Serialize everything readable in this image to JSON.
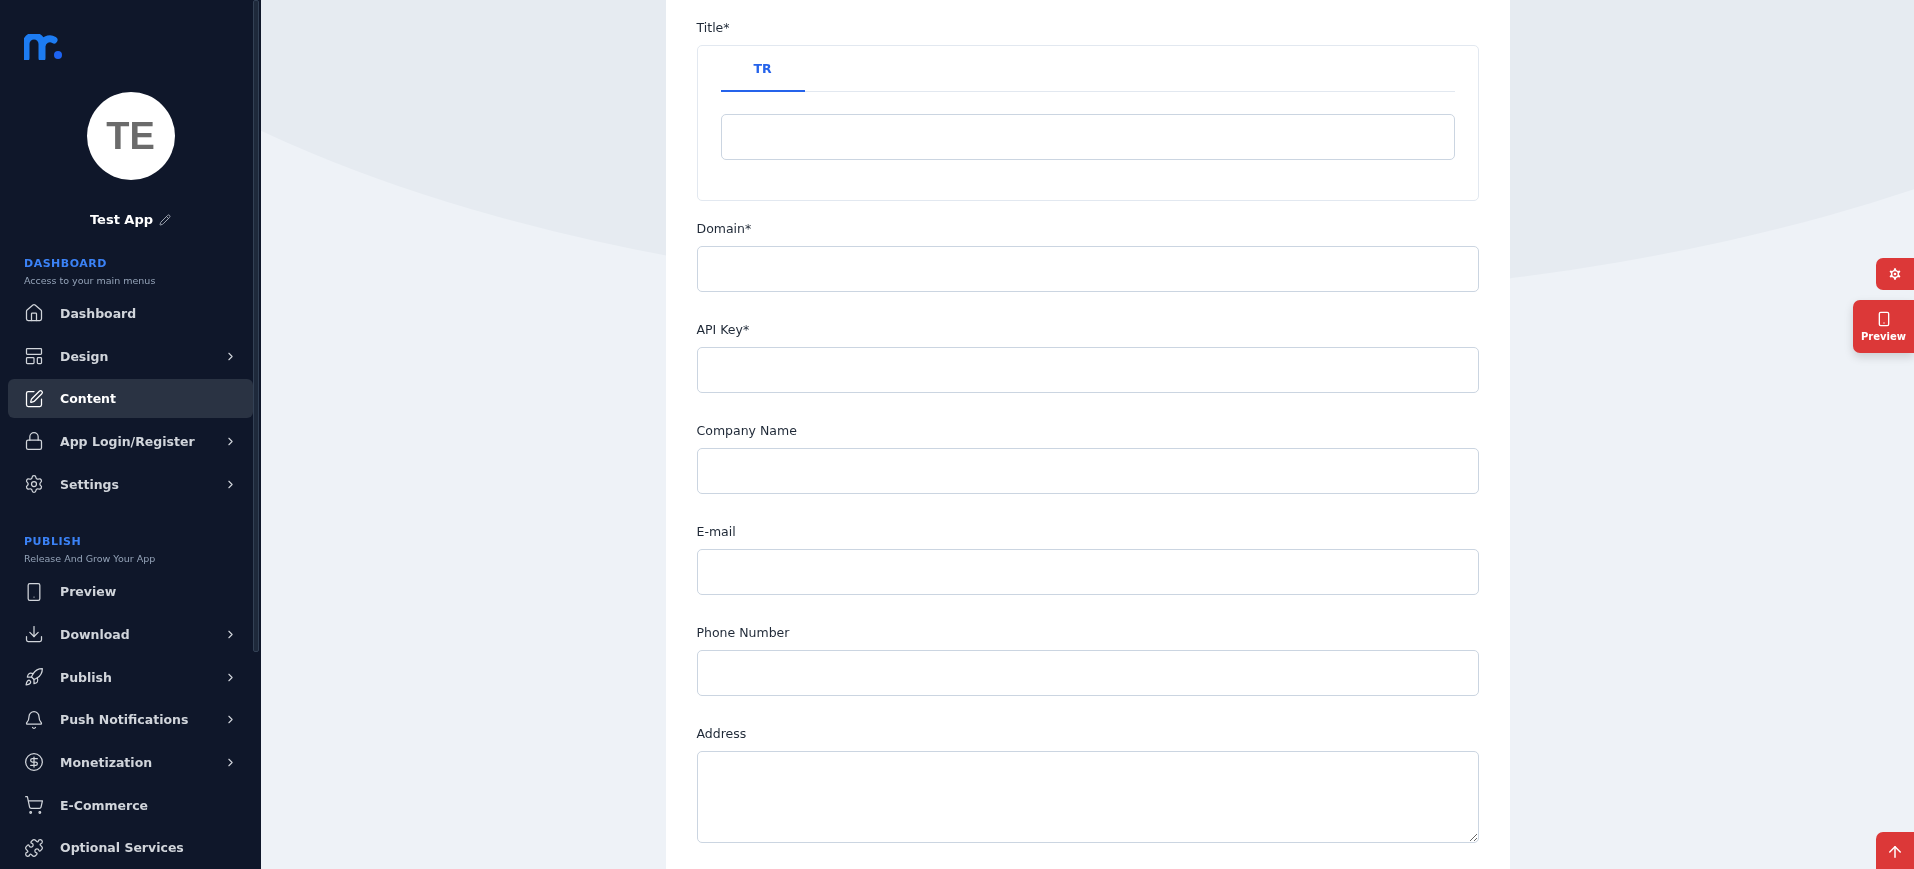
{
  "sidebar": {
    "avatar": "TE",
    "app_name": "Test App",
    "sections": [
      {
        "title": "DASHBOARD",
        "subtitle": "Access to your main menus",
        "items": [
          {
            "label": "Dashboard",
            "has_submenu": false,
            "selected": false
          },
          {
            "label": "Design",
            "has_submenu": true,
            "selected": false
          },
          {
            "label": "Content",
            "has_submenu": false,
            "selected": true
          },
          {
            "label": "App Login/Register",
            "has_submenu": true,
            "selected": false
          },
          {
            "label": "Settings",
            "has_submenu": true,
            "selected": false
          }
        ]
      },
      {
        "title": "PUBLISH",
        "subtitle": "Release And Grow Your App",
        "items": [
          {
            "label": "Preview",
            "has_submenu": false,
            "selected": false
          },
          {
            "label": "Download",
            "has_submenu": true,
            "selected": false
          },
          {
            "label": "Publish",
            "has_submenu": true,
            "selected": false
          },
          {
            "label": "Push Notifications",
            "has_submenu": true,
            "selected": false
          },
          {
            "label": "Monetization",
            "has_submenu": true,
            "selected": false
          },
          {
            "label": "E-Commerce",
            "has_submenu": false,
            "selected": false
          },
          {
            "label": "Optional Services",
            "has_submenu": false,
            "selected": false
          }
        ]
      }
    ]
  },
  "form": {
    "title_field": {
      "label": "Title*",
      "tabs": [
        {
          "label": "TR",
          "selected": true
        }
      ]
    },
    "fields": [
      {
        "label": "Domain*",
        "kind": "input"
      },
      {
        "label": "API Key*",
        "kind": "input"
      },
      {
        "label": "Company Name",
        "kind": "input"
      },
      {
        "label": "E-mail",
        "kind": "input"
      },
      {
        "label": "Phone Number",
        "kind": "input"
      },
      {
        "label": "Address",
        "kind": "textarea"
      }
    ]
  },
  "floating": {
    "preview_label": "Preview"
  }
}
